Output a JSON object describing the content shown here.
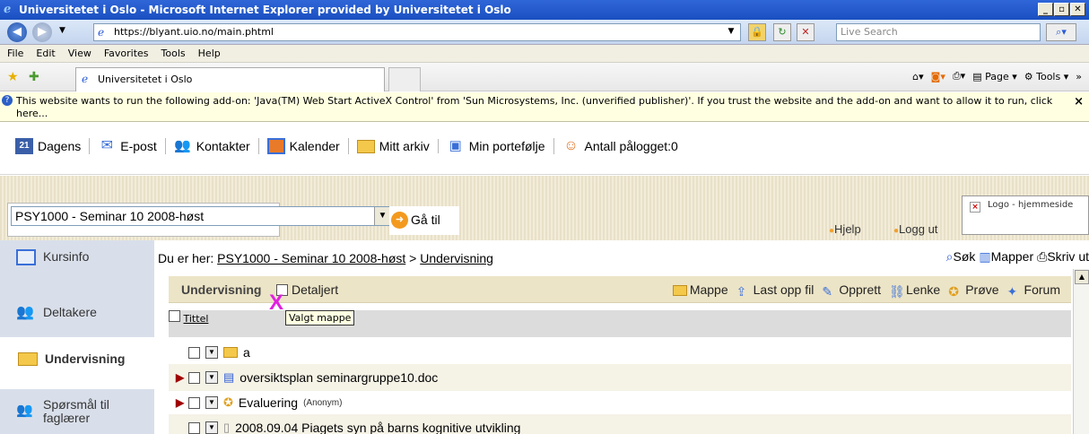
{
  "window": {
    "title": "Universitetet i Oslo - Microsoft Internet Explorer provided by Universitetet i Oslo",
    "buttons": [
      "_",
      "̸",
      "X"
    ]
  },
  "address": {
    "url": "https://blyant.uio.no/main.phtml",
    "search_placeholder": "Live Search"
  },
  "menu": [
    "File",
    "Edit",
    "View",
    "Favorites",
    "Tools",
    "Help"
  ],
  "tab": {
    "title": "Universitetet i Oslo",
    "cmd_page": "Page",
    "cmd_tools": "Tools"
  },
  "infobar": {
    "text": "This website wants to run the following add-on: 'Java(TM) Web Start ActiveX Control' from 'Sun Microsystems, Inc. (unverified publisher)'. If you trust the website and the add-on and want to allow it to run, click here...",
    "close": "×"
  },
  "appnav": [
    {
      "label": "Dagens",
      "icon": "calendar-21-icon"
    },
    {
      "label": "E-post",
      "icon": "envelope-icon"
    },
    {
      "label": "Kontakter",
      "icon": "contacts-icon"
    },
    {
      "label": "Kalender",
      "icon": "calendar-icon"
    },
    {
      "label": "Mitt arkiv",
      "icon": "folder-icon"
    },
    {
      "label": "Min portefølje",
      "icon": "portfolio-icon"
    },
    {
      "label": "Antall pålogget:0",
      "icon": "smiley-icon"
    }
  ],
  "course": {
    "selected": "PSY1000 - Seminar 10  2008-høst",
    "go_label": "Gå til",
    "help": "Hjelp",
    "logout": "Logg ut",
    "logo_alt": "Logo - hjemmeside"
  },
  "sidebar": [
    {
      "label": "Kursinfo",
      "icon": "info-book-icon",
      "active": false
    },
    {
      "label": "Deltakere",
      "icon": "participants-icon",
      "active": false
    },
    {
      "label": "Undervisning",
      "icon": "folder-icon",
      "active": true
    },
    {
      "label": "Spørsmål til faglærer",
      "icon": "question-people-icon",
      "active": false
    }
  ],
  "breadcrumb": {
    "prefix": "Du er her:",
    "course": "PSY1000 - Seminar 10 2008-høst",
    "separator": ">",
    "current": "Undervisning"
  },
  "tools": {
    "search": "Søk",
    "folders": "Mapper",
    "print": "Skriv ut"
  },
  "panel": {
    "title": "Undervisning",
    "detail": "Detaljert",
    "actions": [
      "Mappe",
      "Last opp fil",
      "Opprett",
      "Lenke",
      "Prøve",
      "Forum"
    ],
    "column_title": "Tittel",
    "tooltip": "Valgt mappe",
    "marker": "X",
    "rows": [
      {
        "name": "a",
        "type": "folder",
        "flag": false,
        "extra": ""
      },
      {
        "name": "oversiktsplan seminargruppe10.doc",
        "type": "word",
        "flag": true,
        "extra": ""
      },
      {
        "name": "Evaluering",
        "type": "survey",
        "flag": true,
        "extra": "(Anonym)"
      },
      {
        "name": "2008.09.04 Piagets syn på barns kognitive utvikling",
        "type": "document",
        "flag": false,
        "extra": ""
      }
    ]
  },
  "colors": {
    "accent": "#1a4fc0",
    "sidebar": "#d9dfea",
    "panel_header": "#ece4c6",
    "marker": "#e020e0"
  }
}
